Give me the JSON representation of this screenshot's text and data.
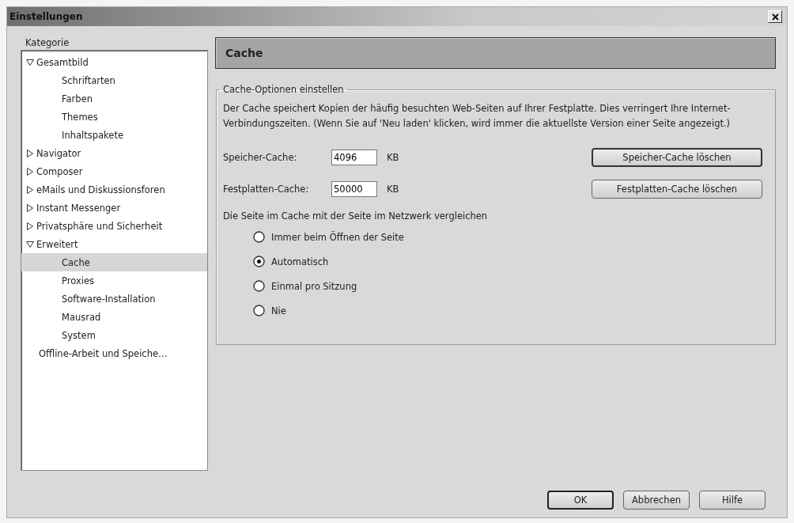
{
  "window": {
    "title": "Einstellungen"
  },
  "sidebar": {
    "label": "Kategorie",
    "items": [
      {
        "label": "Gesamtbild",
        "expanded": true,
        "selected": false,
        "children": [
          {
            "label": "Schriftarten",
            "selected": false
          },
          {
            "label": "Farben",
            "selected": false
          },
          {
            "label": "Themes",
            "selected": false
          },
          {
            "label": "Inhaltspakete",
            "selected": false
          }
        ]
      },
      {
        "label": "Navigator",
        "expanded": false,
        "selected": false
      },
      {
        "label": "Composer",
        "expanded": false,
        "selected": false
      },
      {
        "label": "eMails und Diskussionsforen",
        "expanded": false,
        "selected": false
      },
      {
        "label": "Instant Messenger",
        "expanded": false,
        "selected": false
      },
      {
        "label": "Privatsphäre und Sicherheit",
        "expanded": false,
        "selected": false
      },
      {
        "label": "Erweitert",
        "expanded": true,
        "selected": false,
        "children": [
          {
            "label": "Cache",
            "selected": true
          },
          {
            "label": "Proxies",
            "selected": false
          },
          {
            "label": "Software-Installation",
            "selected": false
          },
          {
            "label": "Mausrad",
            "selected": false
          },
          {
            "label": "System",
            "selected": false
          }
        ]
      },
      {
        "label": "Offline-Arbeit und Speiche…",
        "selected": false
      }
    ]
  },
  "panel": {
    "title": "Cache",
    "group": {
      "legend": "Cache-Optionen einstellen",
      "description": "Der Cache speichert Kopien der häufig besuchten Web-Seiten auf Ihrer Festplatte. Dies verringert Ihre Internet-Verbindungszeiten. (Wenn Sie auf 'Neu laden' klicken, wird immer die aktuellste Version einer Seite angezeigt.)",
      "fields": [
        {
          "label": "Speicher-Cache:",
          "value": "4096",
          "unit": "KB",
          "button": "Speicher-Cache löschen",
          "button_focused": true
        },
        {
          "label": "Festplatten-Cache:",
          "value": "50000",
          "unit": "KB",
          "button": "Festplatten-Cache löschen",
          "button_focused": false
        }
      ],
      "compare_label": "Die Seite im Cache mit der Seite im Netzwerk vergleichen",
      "options": [
        {
          "label": "Immer beim Öffnen der Seite",
          "selected": false
        },
        {
          "label": "Automatisch",
          "selected": true
        },
        {
          "label": "Einmal pro Sitzung",
          "selected": false
        },
        {
          "label": "Nie",
          "selected": false
        }
      ]
    }
  },
  "buttons": [
    {
      "label": "OK",
      "default": true
    },
    {
      "label": "Abbrechen",
      "default": false
    },
    {
      "label": "Hilfe",
      "default": false
    }
  ]
}
